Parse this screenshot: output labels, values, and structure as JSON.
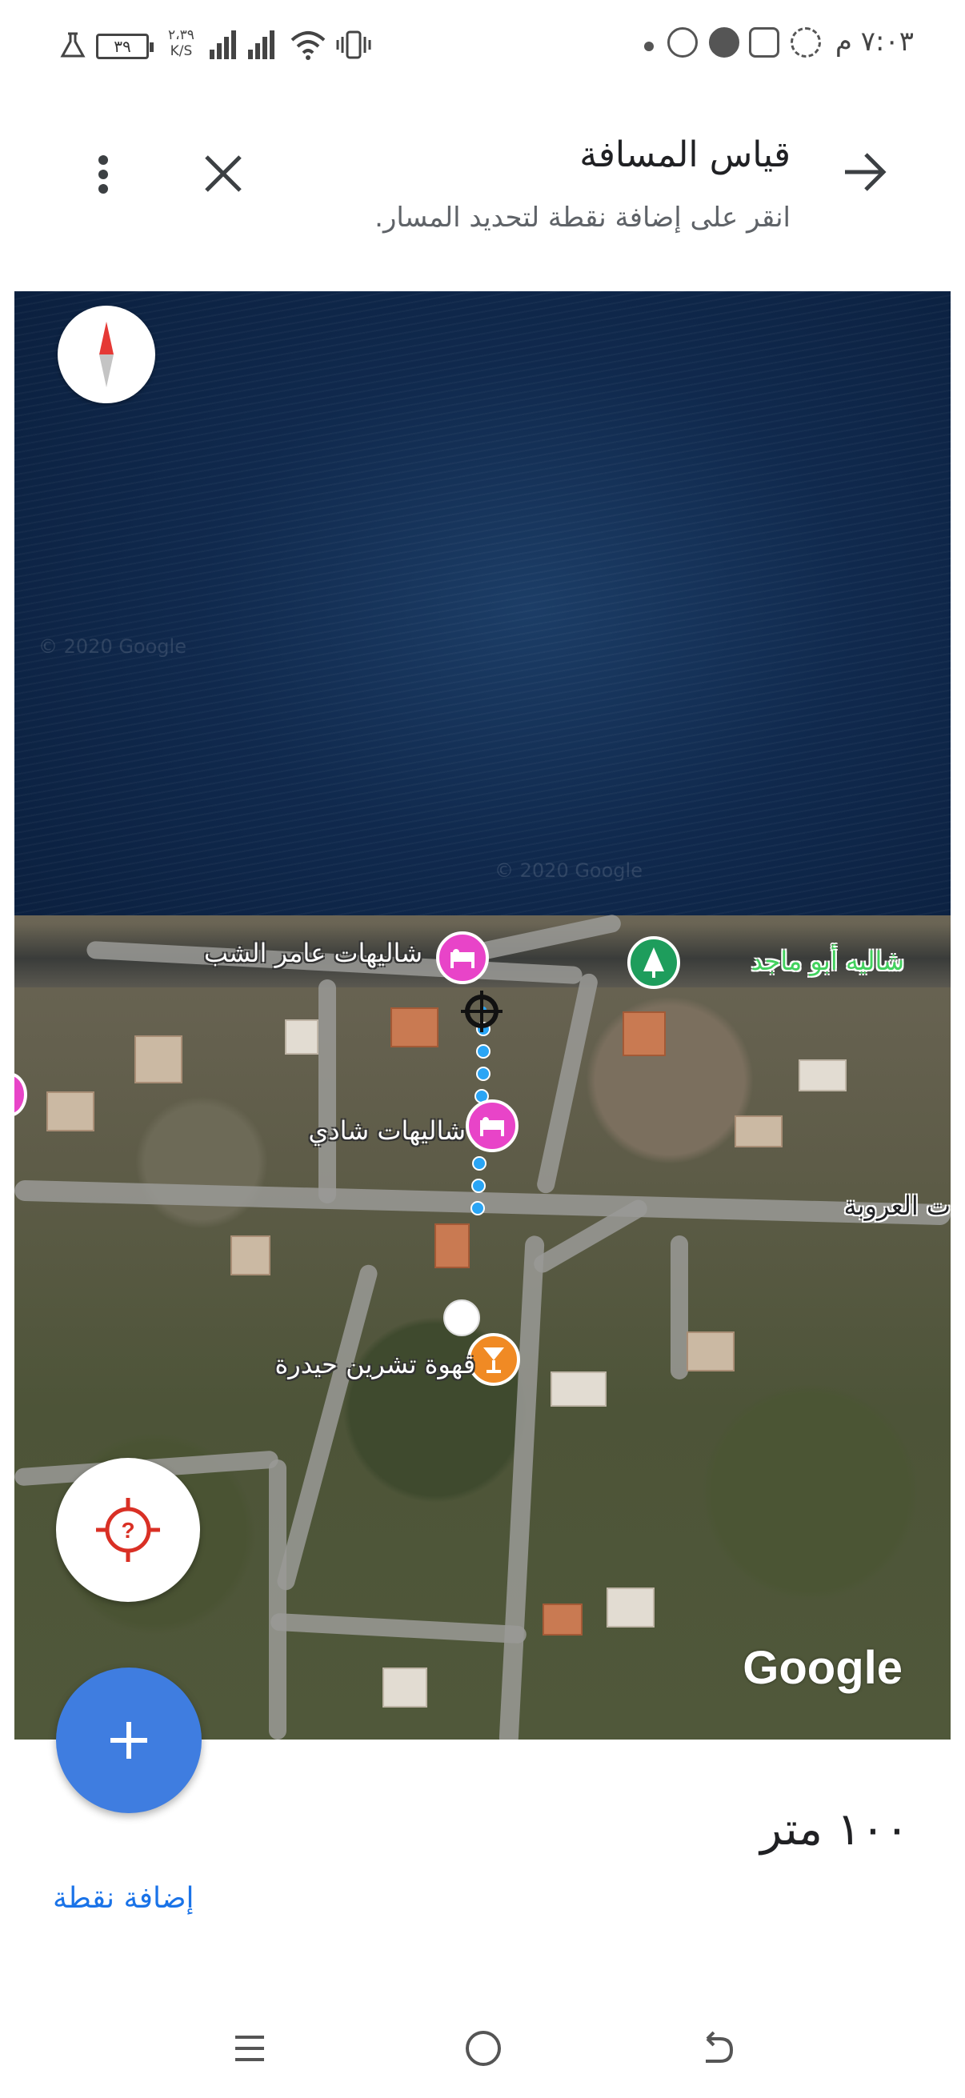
{
  "status_bar": {
    "time": "٧:٠٣ م",
    "battery": "٣٩",
    "net_speed_value": "٢،٣٩",
    "net_speed_unit": "K/S"
  },
  "header": {
    "title": "قياس المسافة",
    "subtitle": "انقر على إضافة نقطة لتحديد المسار."
  },
  "map": {
    "watermark": "© 2020 Google",
    "places": [
      {
        "name": "شاليهات عامر الشب",
        "category": "hotel",
        "color": "#e844c8"
      },
      {
        "name": "شاليهات شادي",
        "category": "hotel",
        "color": "#e844c8"
      },
      {
        "name": "شاليه أبو ماجد",
        "category": "park",
        "color": "#1e9d5c"
      },
      {
        "name": "قهوة تشرين حيدرة",
        "category": "bar",
        "color": "#f08a24"
      }
    ],
    "street": "ت العروبة",
    "logo": "Google",
    "route_color": "#2aa5f5"
  },
  "bottom": {
    "distance": "١٠٠ متر",
    "add_point": "إضافة نقطة"
  },
  "accent": "#3f7de0"
}
